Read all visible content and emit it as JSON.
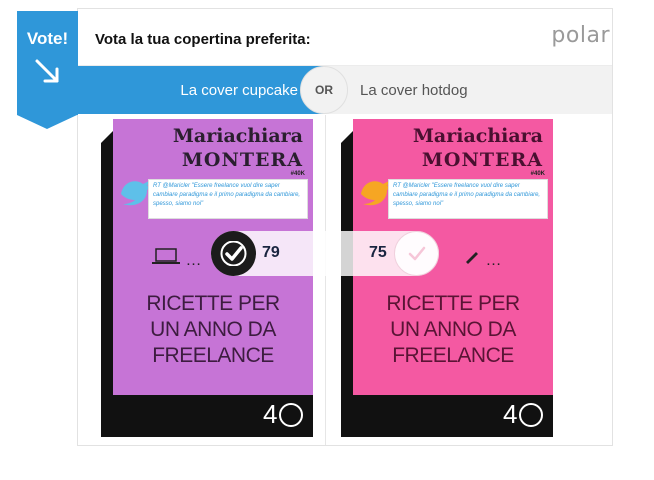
{
  "header": {
    "question": "Vota la tua copertina preferita:",
    "logo": "polar"
  },
  "ribbon": {
    "label": "Vote!"
  },
  "choices": {
    "left_label": "La cover cupcake",
    "or_label": "OR",
    "right_label": "La cover hotdog"
  },
  "covers": [
    {
      "author_first": "Mariachiara",
      "author_last": "MONTERA",
      "tag": "#40K",
      "tweet": "RT @Maricler \"Essere freelance vuol dire saper cambiare paradigma e il primo paradigma da cambiare, spesso, siamo noi\"",
      "title_lines": [
        "RICETTE PER",
        "UN ANNO DA",
        "FREELANCE"
      ],
      "icons": "…",
      "bg_color": "#c674d6"
    },
    {
      "author_first": "Mariachiara",
      "author_last": "MONTERA",
      "tag": "#40K",
      "tweet": "RT @Maricler \"Essere freelance vuol dire saper cambiare paradigma e il primo paradigma da cambiare, spesso, siamo noi\"",
      "title_lines": [
        "RICETTE PER",
        "UN ANNO DA",
        "FREELANCE"
      ],
      "icons": "…",
      "bg_color": "#f459a2"
    }
  ],
  "votes": {
    "left_count": "79",
    "right_count": "75",
    "selected": "left"
  },
  "colors": {
    "accent": "#2f97d9",
    "check_bg": "#1b1b1b"
  },
  "icon_names": [
    "vote-arrow-icon",
    "check-icon",
    "twitter-bird-icon",
    "laptop-icon",
    "pencil-icon",
    "publisher-logo"
  ]
}
